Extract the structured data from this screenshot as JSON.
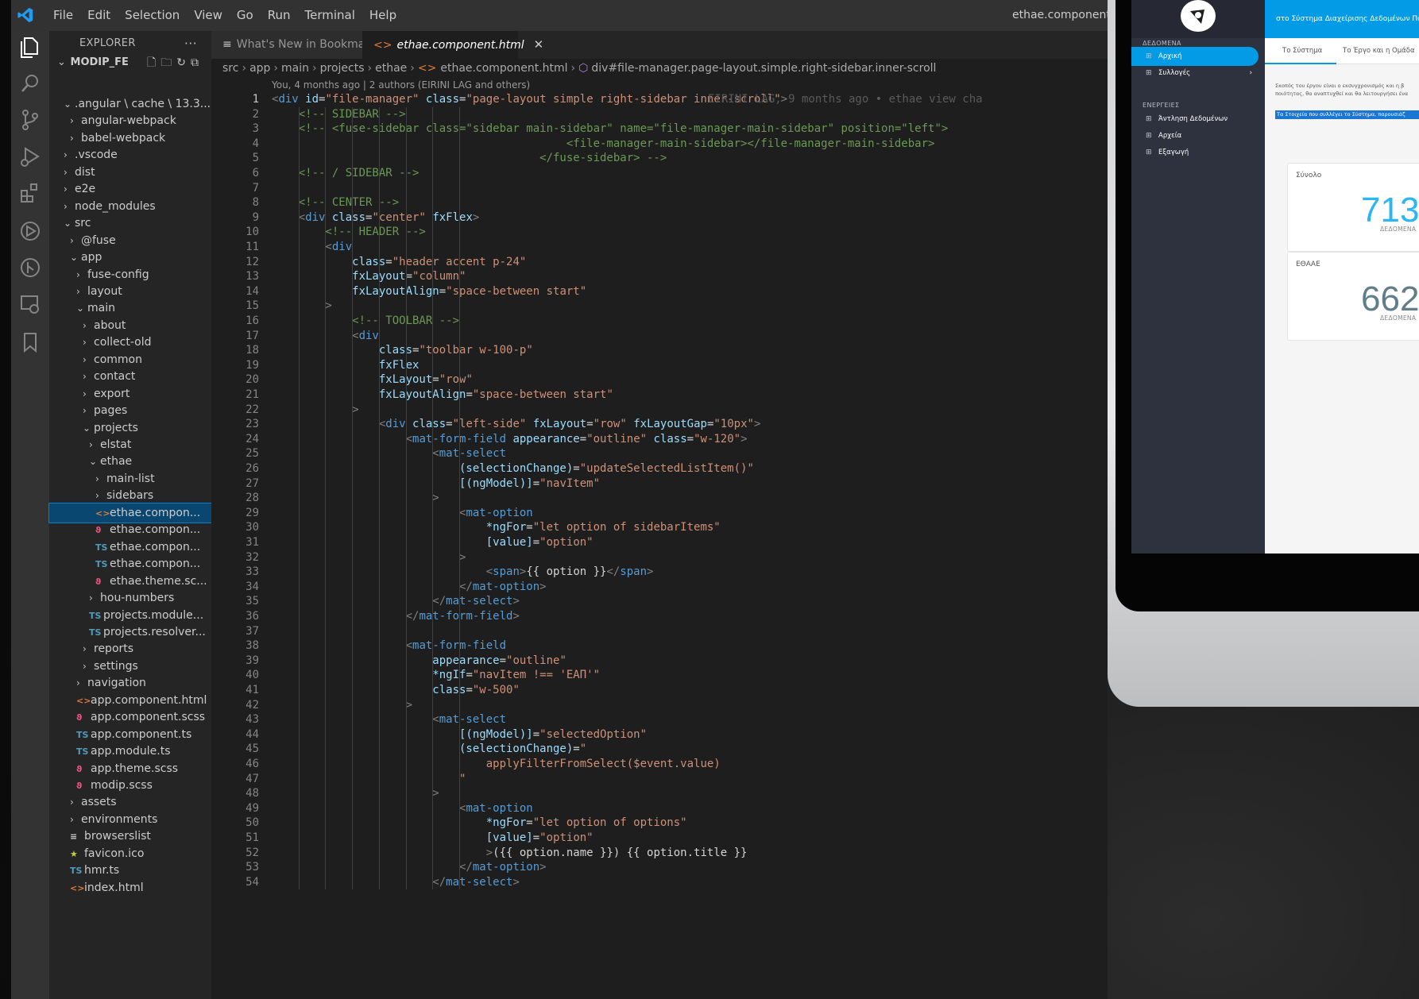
{
  "menu": [
    "File",
    "Edit",
    "Selection",
    "View",
    "Go",
    "Run",
    "Terminal",
    "Help"
  ],
  "window_title": "ethae.component.ht",
  "explorer": {
    "title": "EXPLORER",
    "more": "···",
    "root": "MODIP_FE",
    "items": [
      {
        "label": ".angular \\ cache \\ 13.3....",
        "indent": 1,
        "type": "folder",
        "open": true
      },
      {
        "label": "angular-webpack",
        "indent": 2,
        "type": "folder",
        "open": false
      },
      {
        "label": "babel-webpack",
        "indent": 2,
        "type": "folder",
        "open": false
      },
      {
        "label": ".vscode",
        "indent": 1,
        "type": "folder",
        "open": false
      },
      {
        "label": "dist",
        "indent": 1,
        "type": "folder",
        "open": false
      },
      {
        "label": "e2e",
        "indent": 1,
        "type": "folder",
        "open": false
      },
      {
        "label": "node_modules",
        "indent": 1,
        "type": "folder",
        "open": false
      },
      {
        "label": "src",
        "indent": 1,
        "type": "folder",
        "open": true
      },
      {
        "label": "@fuse",
        "indent": 2,
        "type": "folder",
        "open": false
      },
      {
        "label": "app",
        "indent": 2,
        "type": "folder",
        "open": true
      },
      {
        "label": "fuse-config",
        "indent": 3,
        "type": "folder",
        "open": false
      },
      {
        "label": "layout",
        "indent": 3,
        "type": "folder",
        "open": false
      },
      {
        "label": "main",
        "indent": 3,
        "type": "folder",
        "open": true
      },
      {
        "label": "about",
        "indent": 4,
        "type": "folder",
        "open": false
      },
      {
        "label": "collect-old",
        "indent": 4,
        "type": "folder",
        "open": false
      },
      {
        "label": "common",
        "indent": 4,
        "type": "folder",
        "open": false
      },
      {
        "label": "contact",
        "indent": 4,
        "type": "folder",
        "open": false
      },
      {
        "label": "export",
        "indent": 4,
        "type": "folder",
        "open": false
      },
      {
        "label": "pages",
        "indent": 4,
        "type": "folder",
        "open": false
      },
      {
        "label": "projects",
        "indent": 4,
        "type": "folder",
        "open": true
      },
      {
        "label": "elstat",
        "indent": 5,
        "type": "folder",
        "open": false
      },
      {
        "label": "ethae",
        "indent": 5,
        "type": "folder",
        "open": true
      },
      {
        "label": "main-list",
        "indent": 6,
        "type": "folder",
        "open": false
      },
      {
        "label": "sidebars",
        "indent": 6,
        "type": "folder",
        "open": false
      },
      {
        "label": "ethae.compon...",
        "indent": 6,
        "type": "html",
        "selected": true
      },
      {
        "label": "ethae.compon...",
        "indent": 6,
        "type": "scss"
      },
      {
        "label": "ethae.compon...",
        "indent": 6,
        "type": "ts"
      },
      {
        "label": "ethae.compon...",
        "indent": 6,
        "type": "ts"
      },
      {
        "label": "ethae.theme.sc...",
        "indent": 6,
        "type": "scss"
      },
      {
        "label": "hou-numbers",
        "indent": 5,
        "type": "folder",
        "open": false
      },
      {
        "label": "projects.module...",
        "indent": 5,
        "type": "ts"
      },
      {
        "label": "projects.resolver...",
        "indent": 5,
        "type": "ts"
      },
      {
        "label": "reports",
        "indent": 4,
        "type": "folder",
        "open": false
      },
      {
        "label": "settings",
        "indent": 4,
        "type": "folder",
        "open": false
      },
      {
        "label": "navigation",
        "indent": 3,
        "type": "folder",
        "open": false
      },
      {
        "label": "app.component.html",
        "indent": 3,
        "type": "html"
      },
      {
        "label": "app.component.scss",
        "indent": 3,
        "type": "scss"
      },
      {
        "label": "app.component.ts",
        "indent": 3,
        "type": "ts"
      },
      {
        "label": "app.module.ts",
        "indent": 3,
        "type": "ts"
      },
      {
        "label": "app.theme.scss",
        "indent": 3,
        "type": "scss"
      },
      {
        "label": "modip.scss",
        "indent": 3,
        "type": "scss"
      },
      {
        "label": "assets",
        "indent": 2,
        "type": "folder",
        "open": false
      },
      {
        "label": "environments",
        "indent": 2,
        "type": "folder",
        "open": false
      },
      {
        "label": "browserslist",
        "indent": 2,
        "type": "list"
      },
      {
        "label": "favicon.ico",
        "indent": 2,
        "type": "star"
      },
      {
        "label": "hmr.ts",
        "indent": 2,
        "type": "ts"
      },
      {
        "label": "index.html",
        "indent": 2,
        "type": "html"
      }
    ]
  },
  "tabs": [
    {
      "label": "What's New in Bookmarks",
      "icon": "≡",
      "active": false
    },
    {
      "label": "ethae.component.html",
      "icon": "<>",
      "active": true,
      "close": "✕"
    }
  ],
  "breadcrumb": [
    "src",
    "app",
    "main",
    "projects",
    "ethae",
    "ethae.component.html",
    "div#file-manager.page-layout.simple.right-sidebar.inner-scroll"
  ],
  "blame": {
    "header": "You, 4 months ago | 2 authors (EIRINI LAG and others)",
    "inline": "EIRINI LAG, 9 months ago • ethae view cha"
  },
  "code_lines": [
    [
      {
        "c": "p",
        "t": "<"
      },
      {
        "c": "t",
        "t": "div "
      },
      {
        "c": "a",
        "t": "id"
      },
      {
        "c": "x",
        "t": "="
      },
      {
        "c": "s",
        "t": "\"file-manager\" "
      },
      {
        "c": "a",
        "t": "class"
      },
      {
        "c": "x",
        "t": "="
      },
      {
        "c": "s",
        "t": "\"page-layout simple right-sidebar inner-scroll\""
      },
      {
        "c": "p",
        "t": ">"
      }
    ],
    [
      {
        "c": "c",
        "t": "    <!-- SIDEBAR -->"
      }
    ],
    [
      {
        "c": "c",
        "t": "    <!-- <fuse-sidebar class=\"sidebar main-sidebar\" name=\"file-manager-main-sidebar\" position=\"left\">"
      }
    ],
    [
      {
        "c": "c",
        "t": "                                            <file-manager-main-sidebar></file-manager-main-sidebar>"
      }
    ],
    [
      {
        "c": "c",
        "t": "                                        </fuse-sidebar> -->"
      }
    ],
    [
      {
        "c": "c",
        "t": "    <!-- / SIDEBAR -->"
      }
    ],
    [
      {
        "c": "x",
        "t": ""
      }
    ],
    [
      {
        "c": "c",
        "t": "    <!-- CENTER -->"
      }
    ],
    [
      {
        "c": "p",
        "t": "    <"
      },
      {
        "c": "t",
        "t": "div "
      },
      {
        "c": "a",
        "t": "class"
      },
      {
        "c": "x",
        "t": "="
      },
      {
        "c": "s",
        "t": "\"center\" "
      },
      {
        "c": "a",
        "t": "fxFlex"
      },
      {
        "c": "p",
        "t": ">"
      }
    ],
    [
      {
        "c": "c",
        "t": "        <!-- HEADER -->"
      }
    ],
    [
      {
        "c": "p",
        "t": "        <"
      },
      {
        "c": "t",
        "t": "div"
      }
    ],
    [
      {
        "c": "a",
        "t": "            class"
      },
      {
        "c": "x",
        "t": "="
      },
      {
        "c": "s",
        "t": "\"header accent p-24\""
      }
    ],
    [
      {
        "c": "a",
        "t": "            fxLayout"
      },
      {
        "c": "x",
        "t": "="
      },
      {
        "c": "s",
        "t": "\"column\""
      }
    ],
    [
      {
        "c": "a",
        "t": "            fxLayoutAlign"
      },
      {
        "c": "x",
        "t": "="
      },
      {
        "c": "s",
        "t": "\"space-between start\""
      }
    ],
    [
      {
        "c": "p",
        "t": "        >"
      }
    ],
    [
      {
        "c": "c",
        "t": "            <!-- TOOLBAR -->"
      }
    ],
    [
      {
        "c": "p",
        "t": "            <"
      },
      {
        "c": "t",
        "t": "div"
      }
    ],
    [
      {
        "c": "a",
        "t": "                class"
      },
      {
        "c": "x",
        "t": "="
      },
      {
        "c": "s",
        "t": "\"toolbar w-100-p\""
      }
    ],
    [
      {
        "c": "a",
        "t": "                fxFlex"
      }
    ],
    [
      {
        "c": "a",
        "t": "                fxLayout"
      },
      {
        "c": "x",
        "t": "="
      },
      {
        "c": "s",
        "t": "\"row\""
      }
    ],
    [
      {
        "c": "a",
        "t": "                fxLayoutAlign"
      },
      {
        "c": "x",
        "t": "="
      },
      {
        "c": "s",
        "t": "\"space-between start\""
      }
    ],
    [
      {
        "c": "p",
        "t": "            >"
      }
    ],
    [
      {
        "c": "p",
        "t": "                <"
      },
      {
        "c": "t",
        "t": "div "
      },
      {
        "c": "a",
        "t": "class"
      },
      {
        "c": "x",
        "t": "="
      },
      {
        "c": "s",
        "t": "\"left-side\" "
      },
      {
        "c": "a",
        "t": "fxLayout"
      },
      {
        "c": "x",
        "t": "="
      },
      {
        "c": "s",
        "t": "\"row\" "
      },
      {
        "c": "a",
        "t": "fxLayoutGap"
      },
      {
        "c": "x",
        "t": "="
      },
      {
        "c": "s",
        "t": "\"10px\""
      },
      {
        "c": "p",
        "t": ">"
      }
    ],
    [
      {
        "c": "p",
        "t": "                    <"
      },
      {
        "c": "t",
        "t": "mat-form-field "
      },
      {
        "c": "a",
        "t": "appearance"
      },
      {
        "c": "x",
        "t": "="
      },
      {
        "c": "s",
        "t": "\"outline\" "
      },
      {
        "c": "a",
        "t": "class"
      },
      {
        "c": "x",
        "t": "="
      },
      {
        "c": "s",
        "t": "\"w-120\""
      },
      {
        "c": "p",
        "t": ">"
      }
    ],
    [
      {
        "c": "p",
        "t": "                        <"
      },
      {
        "c": "t",
        "t": "mat-select"
      }
    ],
    [
      {
        "c": "a",
        "t": "                            (selectionChange)"
      },
      {
        "c": "x",
        "t": "="
      },
      {
        "c": "s",
        "t": "\"updateSelectedListItem()\""
      }
    ],
    [
      {
        "c": "a",
        "t": "                            [(ngModel)]"
      },
      {
        "c": "x",
        "t": "="
      },
      {
        "c": "s",
        "t": "\"navItem\""
      }
    ],
    [
      {
        "c": "p",
        "t": "                        >"
      }
    ],
    [
      {
        "c": "p",
        "t": "                            <"
      },
      {
        "c": "t",
        "t": "mat-option"
      }
    ],
    [
      {
        "c": "a",
        "t": "                                *ngFor"
      },
      {
        "c": "x",
        "t": "="
      },
      {
        "c": "s",
        "t": "\"let option of sidebarItems\""
      }
    ],
    [
      {
        "c": "a",
        "t": "                                [value]"
      },
      {
        "c": "x",
        "t": "="
      },
      {
        "c": "s",
        "t": "\"option\""
      }
    ],
    [
      {
        "c": "p",
        "t": "                            >"
      }
    ],
    [
      {
        "c": "p",
        "t": "                                <"
      },
      {
        "c": "t",
        "t": "span"
      },
      {
        "c": "p",
        "t": ">"
      },
      {
        "c": "x",
        "t": "{{ option }}"
      },
      {
        "c": "p",
        "t": "</"
      },
      {
        "c": "t",
        "t": "span"
      },
      {
        "c": "p",
        "t": ">"
      }
    ],
    [
      {
        "c": "p",
        "t": "                            </"
      },
      {
        "c": "t",
        "t": "mat-option"
      },
      {
        "c": "p",
        "t": ">"
      }
    ],
    [
      {
        "c": "p",
        "t": "                        </"
      },
      {
        "c": "t",
        "t": "mat-select"
      },
      {
        "c": "p",
        "t": ">"
      }
    ],
    [
      {
        "c": "p",
        "t": "                    </"
      },
      {
        "c": "t",
        "t": "mat-form-field"
      },
      {
        "c": "p",
        "t": ">"
      }
    ],
    [
      {
        "c": "x",
        "t": ""
      }
    ],
    [
      {
        "c": "p",
        "t": "                    <"
      },
      {
        "c": "t",
        "t": "mat-form-field"
      }
    ],
    [
      {
        "c": "a",
        "t": "                        appearance"
      },
      {
        "c": "x",
        "t": "="
      },
      {
        "c": "s",
        "t": "\"outline\""
      }
    ],
    [
      {
        "c": "a",
        "t": "                        *ngIf"
      },
      {
        "c": "x",
        "t": "="
      },
      {
        "c": "s",
        "t": "\"navItem !== 'ΕΑΠ'\""
      }
    ],
    [
      {
        "c": "a",
        "t": "                        class"
      },
      {
        "c": "x",
        "t": "="
      },
      {
        "c": "s",
        "t": "\"w-500\""
      }
    ],
    [
      {
        "c": "p",
        "t": "                    >"
      }
    ],
    [
      {
        "c": "p",
        "t": "                        <"
      },
      {
        "c": "t",
        "t": "mat-select"
      }
    ],
    [
      {
        "c": "a",
        "t": "                            [(ngModel)]"
      },
      {
        "c": "x",
        "t": "="
      },
      {
        "c": "s",
        "t": "\"selectedOption\""
      }
    ],
    [
      {
        "c": "a",
        "t": "                            (selectionChange)"
      },
      {
        "c": "x",
        "t": "="
      },
      {
        "c": "s",
        "t": "\""
      }
    ],
    [
      {
        "c": "s",
        "t": "                                applyFilterFromSelect($event.value)"
      }
    ],
    [
      {
        "c": "s",
        "t": "                            \""
      }
    ],
    [
      {
        "c": "p",
        "t": "                        >"
      }
    ],
    [
      {
        "c": "p",
        "t": "                            <"
      },
      {
        "c": "t",
        "t": "mat-option"
      }
    ],
    [
      {
        "c": "a",
        "t": "                                *ngFor"
      },
      {
        "c": "x",
        "t": "="
      },
      {
        "c": "s",
        "t": "\"let option of options\""
      }
    ],
    [
      {
        "c": "a",
        "t": "                                [value]"
      },
      {
        "c": "x",
        "t": "="
      },
      {
        "c": "s",
        "t": "\"option\""
      }
    ],
    [
      {
        "c": "p",
        "t": "                                >"
      },
      {
        "c": "x",
        "t": "({{ option.name }}) {{ option.title }}"
      }
    ],
    [
      {
        "c": "p",
        "t": "                            </"
      },
      {
        "c": "t",
        "t": "mat-option"
      },
      {
        "c": "p",
        "t": ">"
      }
    ],
    [
      {
        "c": "p",
        "t": "                        </"
      },
      {
        "c": "t",
        "t": "mat-select"
      },
      {
        "c": "p",
        "t": ">"
      }
    ]
  ],
  "colors": {
    "accent": "#039be5",
    "editor_bg": "#1e1e1e",
    "selection": "#094771"
  },
  "webapp": {
    "header_text": "στο Σύστημα Διαχείρισης Δεδομένων Ποιό",
    "tabs": [
      "Το Σύστημα",
      "Το Έργο και η Ομάδα"
    ],
    "nav_sections": [
      "ΔΕΔΟΜΕΝΑ",
      "ΕΝΕΡΓΕΙΕΣ"
    ],
    "nav_items": [
      {
        "label": "Αρχική",
        "active": true,
        "icon": "⊞"
      },
      {
        "label": "Συλλογές",
        "active": false,
        "icon": "⊞",
        "arrow": "›"
      },
      {
        "label": "Άντληση Δεδομένων",
        "active": false,
        "icon": "⊞"
      },
      {
        "label": "Αρχεία",
        "active": false,
        "icon": "⊞"
      },
      {
        "label": "Εξαγωγή",
        "active": false,
        "icon": "⊞"
      }
    ],
    "paragraph": [
      "Σκοπός του έργου είναι ο εκσυγχρονισμός και η β",
      "ποιότητας, θα αναπτυχθεί και θα λειτουργήσει ένα"
    ],
    "highlight": "Τα Στοιχεία που συλλέγει το Σύστημα, παρουσιάζ",
    "cards": [
      {
        "label": "Σύνολο",
        "value": "713",
        "sub": "ΔΕΔΟΜΕΝΑ",
        "color": "#29b6f6"
      },
      {
        "label": "ΕΘΑΑΕ",
        "value": "662",
        "sub": "ΔΕΔΟΜΕΝΑ",
        "color": "#607d8b"
      }
    ]
  }
}
